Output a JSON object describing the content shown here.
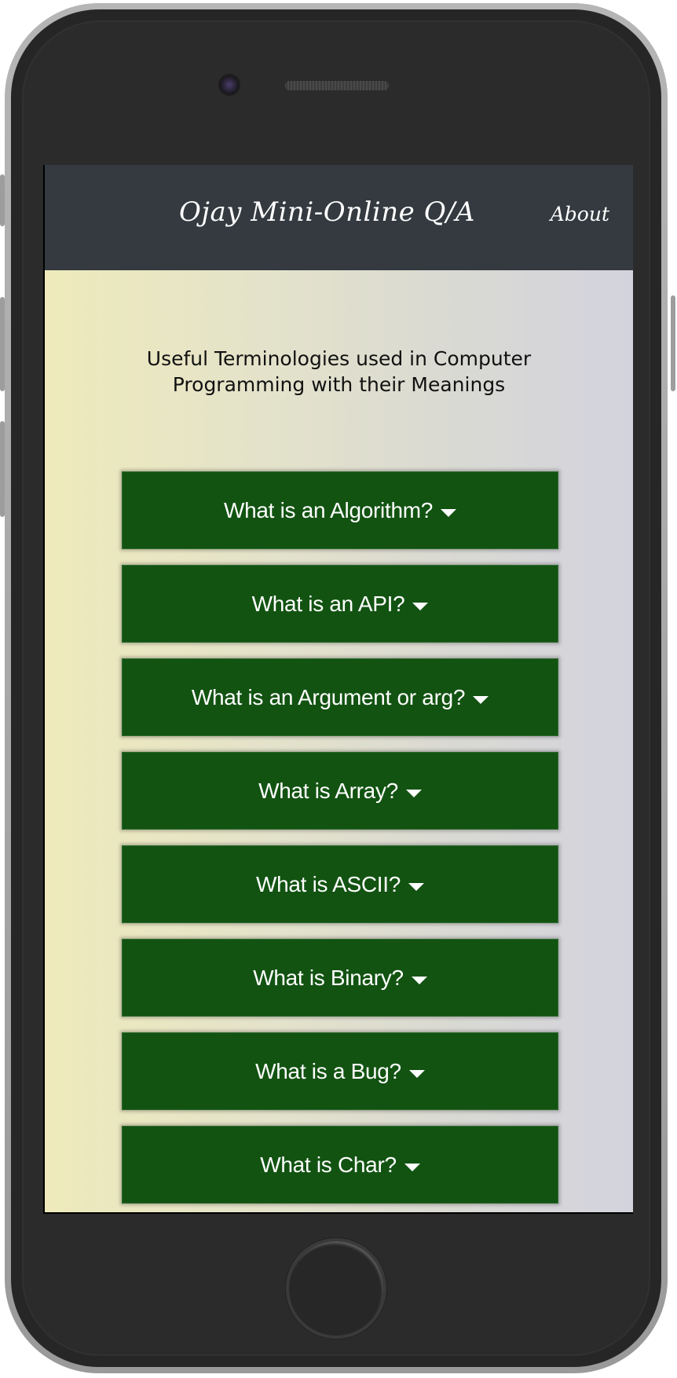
{
  "navbar": {
    "brand": "Ojay Mini-Online Q/A",
    "about": "About"
  },
  "main": {
    "heading": "Useful Terminologies used in Computer Programming with their Meanings",
    "questions": [
      {
        "label": "What is an Algorithm?",
        "icon": "caret-down-icon"
      },
      {
        "label": "What is an API?",
        "icon": "caret-down-icon"
      },
      {
        "label": "What is an Argument or arg?",
        "icon": "caret-down-icon"
      },
      {
        "label": "What is Array?",
        "icon": "caret-down-icon"
      },
      {
        "label": "What is ASCII?",
        "icon": "caret-down-icon"
      },
      {
        "label": "What is Binary?",
        "icon": "caret-down-icon"
      },
      {
        "label": "What is a Bug?",
        "icon": "caret-down-icon"
      },
      {
        "label": "What is Char?",
        "icon": "caret-down-icon"
      }
    ]
  },
  "colors": {
    "navbar_bg": "#343a40",
    "question_bg": "#125312",
    "page_gradient_start": "#eeeabb",
    "page_gradient_end": "#d3d3de"
  }
}
